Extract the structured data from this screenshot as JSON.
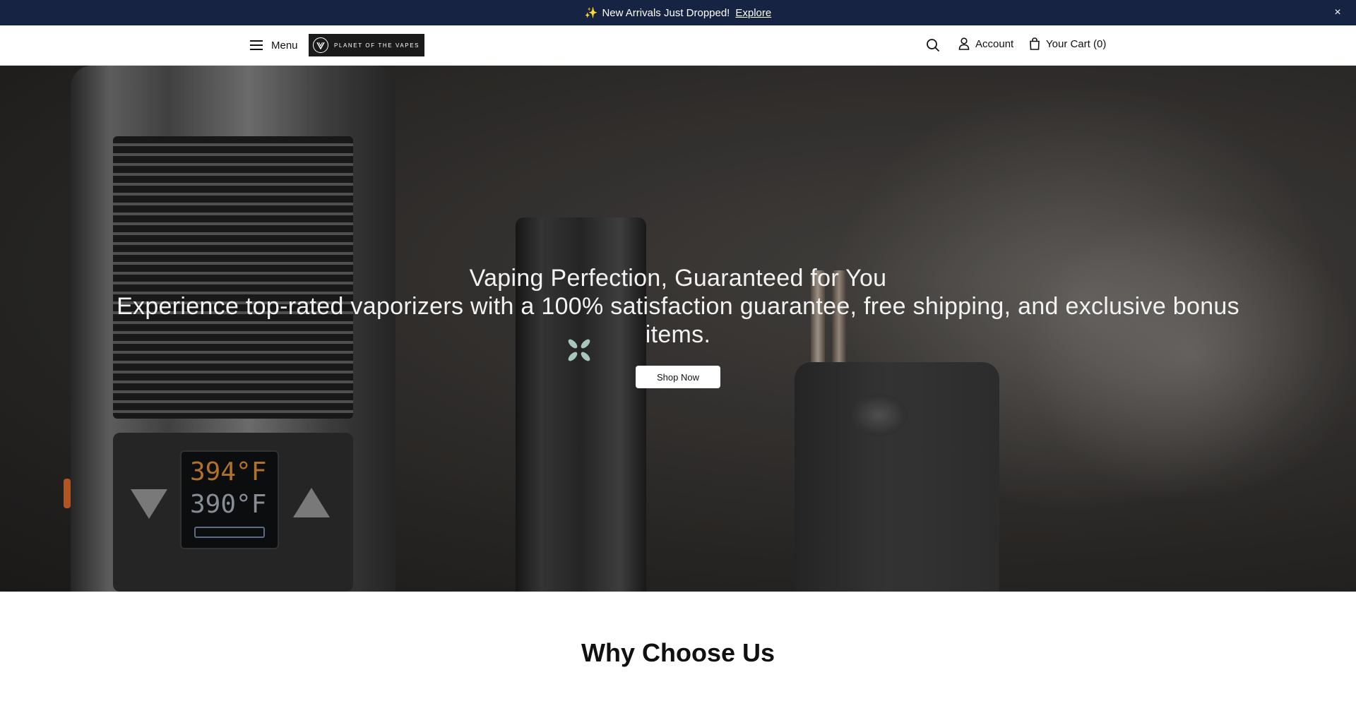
{
  "announcement": {
    "sparkle_icon": "sparkles-icon",
    "message": "New Arrivals Just Dropped!",
    "link_label": "Explore",
    "close_label": "×",
    "background": "#172342"
  },
  "header": {
    "menu_label": "Menu",
    "logo_text": "PLANET OF THE VAPES",
    "account_label": "Account",
    "cart_label": "Your Cart (0)"
  },
  "hero": {
    "title": "Vaping Perfection, Guaranteed for You",
    "subtitle": "Experience top-rated vaporizers with a 100% satisfaction guarantee, free shipping, and exclusive bonus items.",
    "cta_label": "Shop Now",
    "device_display_top": "394°F",
    "device_display_bottom": "390°F"
  },
  "why_section": {
    "heading": "Why Choose Us"
  }
}
